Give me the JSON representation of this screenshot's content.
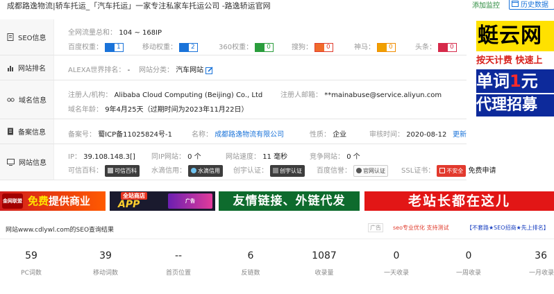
{
  "header": {
    "title": "成都路逸物流|轿车托运_「汽车托运」一家专注私家车托运公司 -路逸轿运官网",
    "add_monitor": "添加监控",
    "history": "历史数据"
  },
  "seo": {
    "label": "SEO信息",
    "traffic_label": "全网流量总和：",
    "traffic_value": "104 ~ 168IP",
    "weights": [
      {
        "label": "百度权重：",
        "value": "1",
        "color": "#1a73d9"
      },
      {
        "label": "移动权重：",
        "value": "2",
        "color": "#1a73d9"
      },
      {
        "label": "360权重：",
        "value": "0",
        "color": "#2a9d3c"
      },
      {
        "label": "搜狗：",
        "value": "0",
        "color": "#e03c2d"
      },
      {
        "label": "神马：",
        "value": "0",
        "color": "#f08c00"
      },
      {
        "label": "头条：",
        "value": "0",
        "color": "#d62a4a"
      }
    ]
  },
  "ranking": {
    "label": "网站排名",
    "alexa_label": "ALEXA世界排名：",
    "alexa_value": "-",
    "category_label": "网站分类：",
    "category_value": "汽车网站"
  },
  "domain": {
    "label": "域名信息",
    "registrant_label": "注册人/机构：",
    "registrant_value": "Alibaba Cloud Computing (Beijing) Co., Ltd",
    "email_label": "注册人邮箱：",
    "email_value": "**mainabuse@service.aliyun.com",
    "age_label": "域名年龄：",
    "age_value": "9年4月25天（过期时间为2023年11月22日）"
  },
  "icp": {
    "label": "备案信息",
    "number_label": "备案号：",
    "number_value": "蜀ICP备11025824号-1",
    "name_label": "名称：",
    "name_value": "成都路逸物流有限公司",
    "nature_label": "性质：",
    "nature_value": "企业",
    "date_label": "审核时间：",
    "date_value": "2020-08-12",
    "update": "更新"
  },
  "site": {
    "label": "网站信息",
    "ip_label": "IP：",
    "ip_value": "39.108.148.3[]",
    "same_ip_label": "同IP网站：",
    "same_ip_value": "0 个",
    "speed_label": "网站速度：",
    "speed_value": "11 毫秒",
    "compete_label": "竞争网站：",
    "compete_value": "0 个",
    "trust": [
      {
        "label": "可信百科：",
        "stamp": "可信百科"
      },
      {
        "label": "水滴信用：",
        "stamp": "水滴信用"
      },
      {
        "label": "创宇认证：",
        "stamp": "创宇认证"
      },
      {
        "label": "百度信誉：",
        "stamp": "官网认证"
      }
    ],
    "ssl_label": "SSL证书：",
    "ssl_stamp": "不安全",
    "ssl_apply": "免费申请"
  },
  "side_ad": {
    "line1": "蜓云网",
    "line2": "按天计费 快速上",
    "line3a": "单词",
    "line3b": "1",
    "line3c": "元",
    "line4": "代理招募"
  },
  "banners": {
    "b1_logo": "金网联盟",
    "b1_text_a": "免费",
    "b1_text_b": "提供商业",
    "b2_a": "全站商店",
    "b2_b": "APP",
    "b2_c": "广告",
    "b3": "友情链接、外链代发",
    "b4": "老站长都在这儿"
  },
  "results": {
    "title": "网站www.cdlywl.com的SEO查询结果",
    "ad_tag": "广告",
    "seo_link": "seo专业优化 支持测试",
    "ad_link": "【不套路★SEO招商★先上排名】"
  },
  "stats": [
    {
      "value": "59",
      "label": "PC词数"
    },
    {
      "value": "39",
      "label": "移动词数"
    },
    {
      "value": "--",
      "label": "首页位置"
    },
    {
      "value": "6",
      "label": "反链数"
    },
    {
      "value": "1087",
      "label": "收录量"
    },
    {
      "value": "0",
      "label": "一天收录"
    },
    {
      "value": "0",
      "label": "一周收录"
    },
    {
      "value": "36",
      "label": "一月收录"
    }
  ]
}
